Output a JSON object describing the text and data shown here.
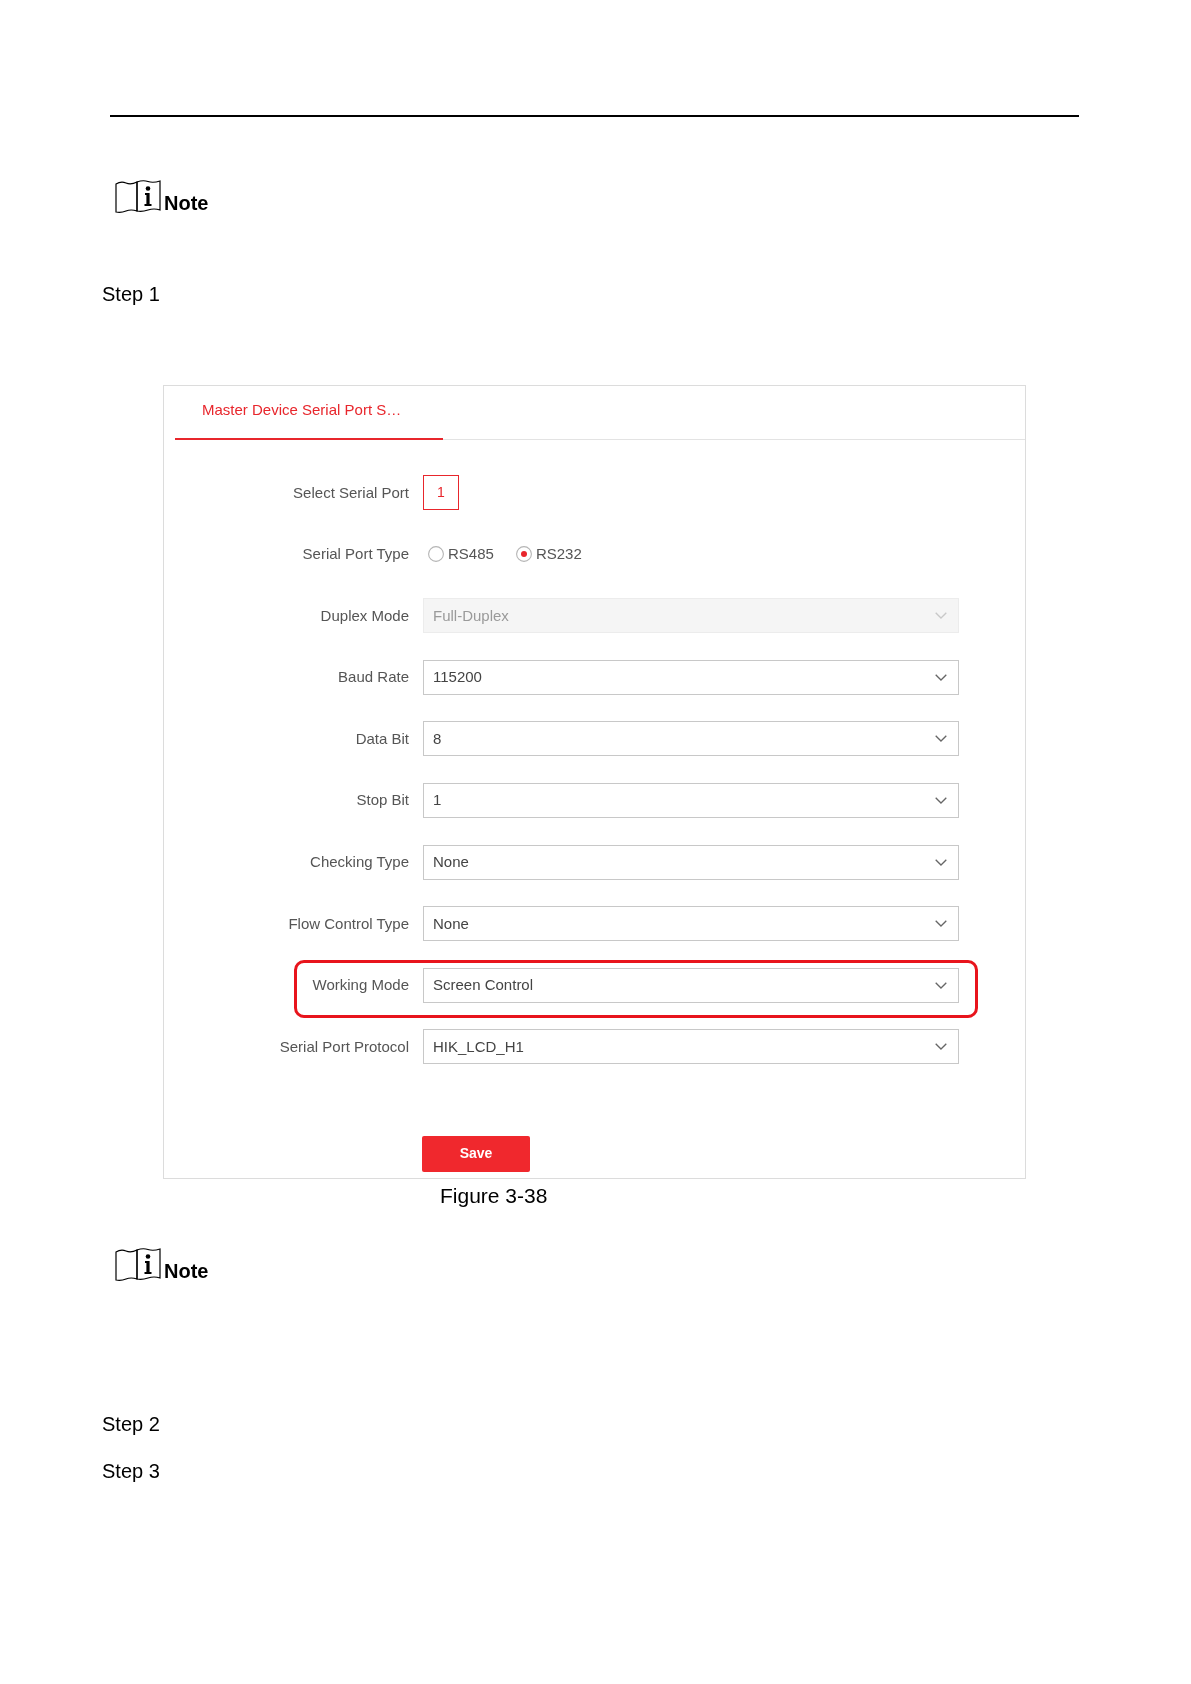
{
  "blocks": [
    {
      "kind": "note",
      "label": "Note"
    },
    {
      "kind": "step",
      "label": "Step 1"
    },
    {
      "kind": "figure",
      "tabs": [
        {
          "label": "Master Device Serial Port S…",
          "selected": true
        }
      ],
      "fields": [
        {
          "kind": "ports",
          "label": "Select Serial Port",
          "disabled": false,
          "highlighted": false,
          "ports": [
            {
              "label": "1",
              "selected": true
            }
          ]
        },
        {
          "kind": "radio",
          "label": "Serial Port Type",
          "disabled": false,
          "highlighted": false,
          "options": [
            {
              "label": "RS485",
              "selected": false
            },
            {
              "label": "RS232",
              "selected": true
            }
          ]
        },
        {
          "kind": "dropdown",
          "label": "Duplex Mode",
          "value": "Full-Duplex",
          "disabled": true,
          "highlighted": false
        },
        {
          "kind": "dropdown",
          "label": "Baud Rate",
          "value": "115200",
          "disabled": false,
          "highlighted": false
        },
        {
          "kind": "dropdown",
          "label": "Data Bit",
          "value": "8",
          "disabled": false,
          "highlighted": false
        },
        {
          "kind": "dropdown",
          "label": "Stop Bit",
          "value": "1",
          "disabled": false,
          "highlighted": false
        },
        {
          "kind": "dropdown",
          "label": "Checking Type",
          "value": "None",
          "disabled": false,
          "highlighted": false
        },
        {
          "kind": "dropdown",
          "label": "Flow Control Type",
          "value": "None",
          "disabled": false,
          "highlighted": false
        },
        {
          "kind": "dropdown",
          "label": "Working Mode",
          "value": "Screen Control",
          "disabled": false,
          "highlighted": true
        },
        {
          "kind": "dropdown",
          "label": "Serial Port Protocol",
          "value": "HIK_LCD_H1",
          "disabled": false,
          "highlighted": false
        }
      ],
      "save_button": "Save",
      "caption": "Figure 3-38"
    },
    {
      "kind": "note",
      "label": "Note"
    },
    {
      "kind": "step",
      "label": "Step 2"
    },
    {
      "kind": "step",
      "label": "Step 3"
    }
  ]
}
